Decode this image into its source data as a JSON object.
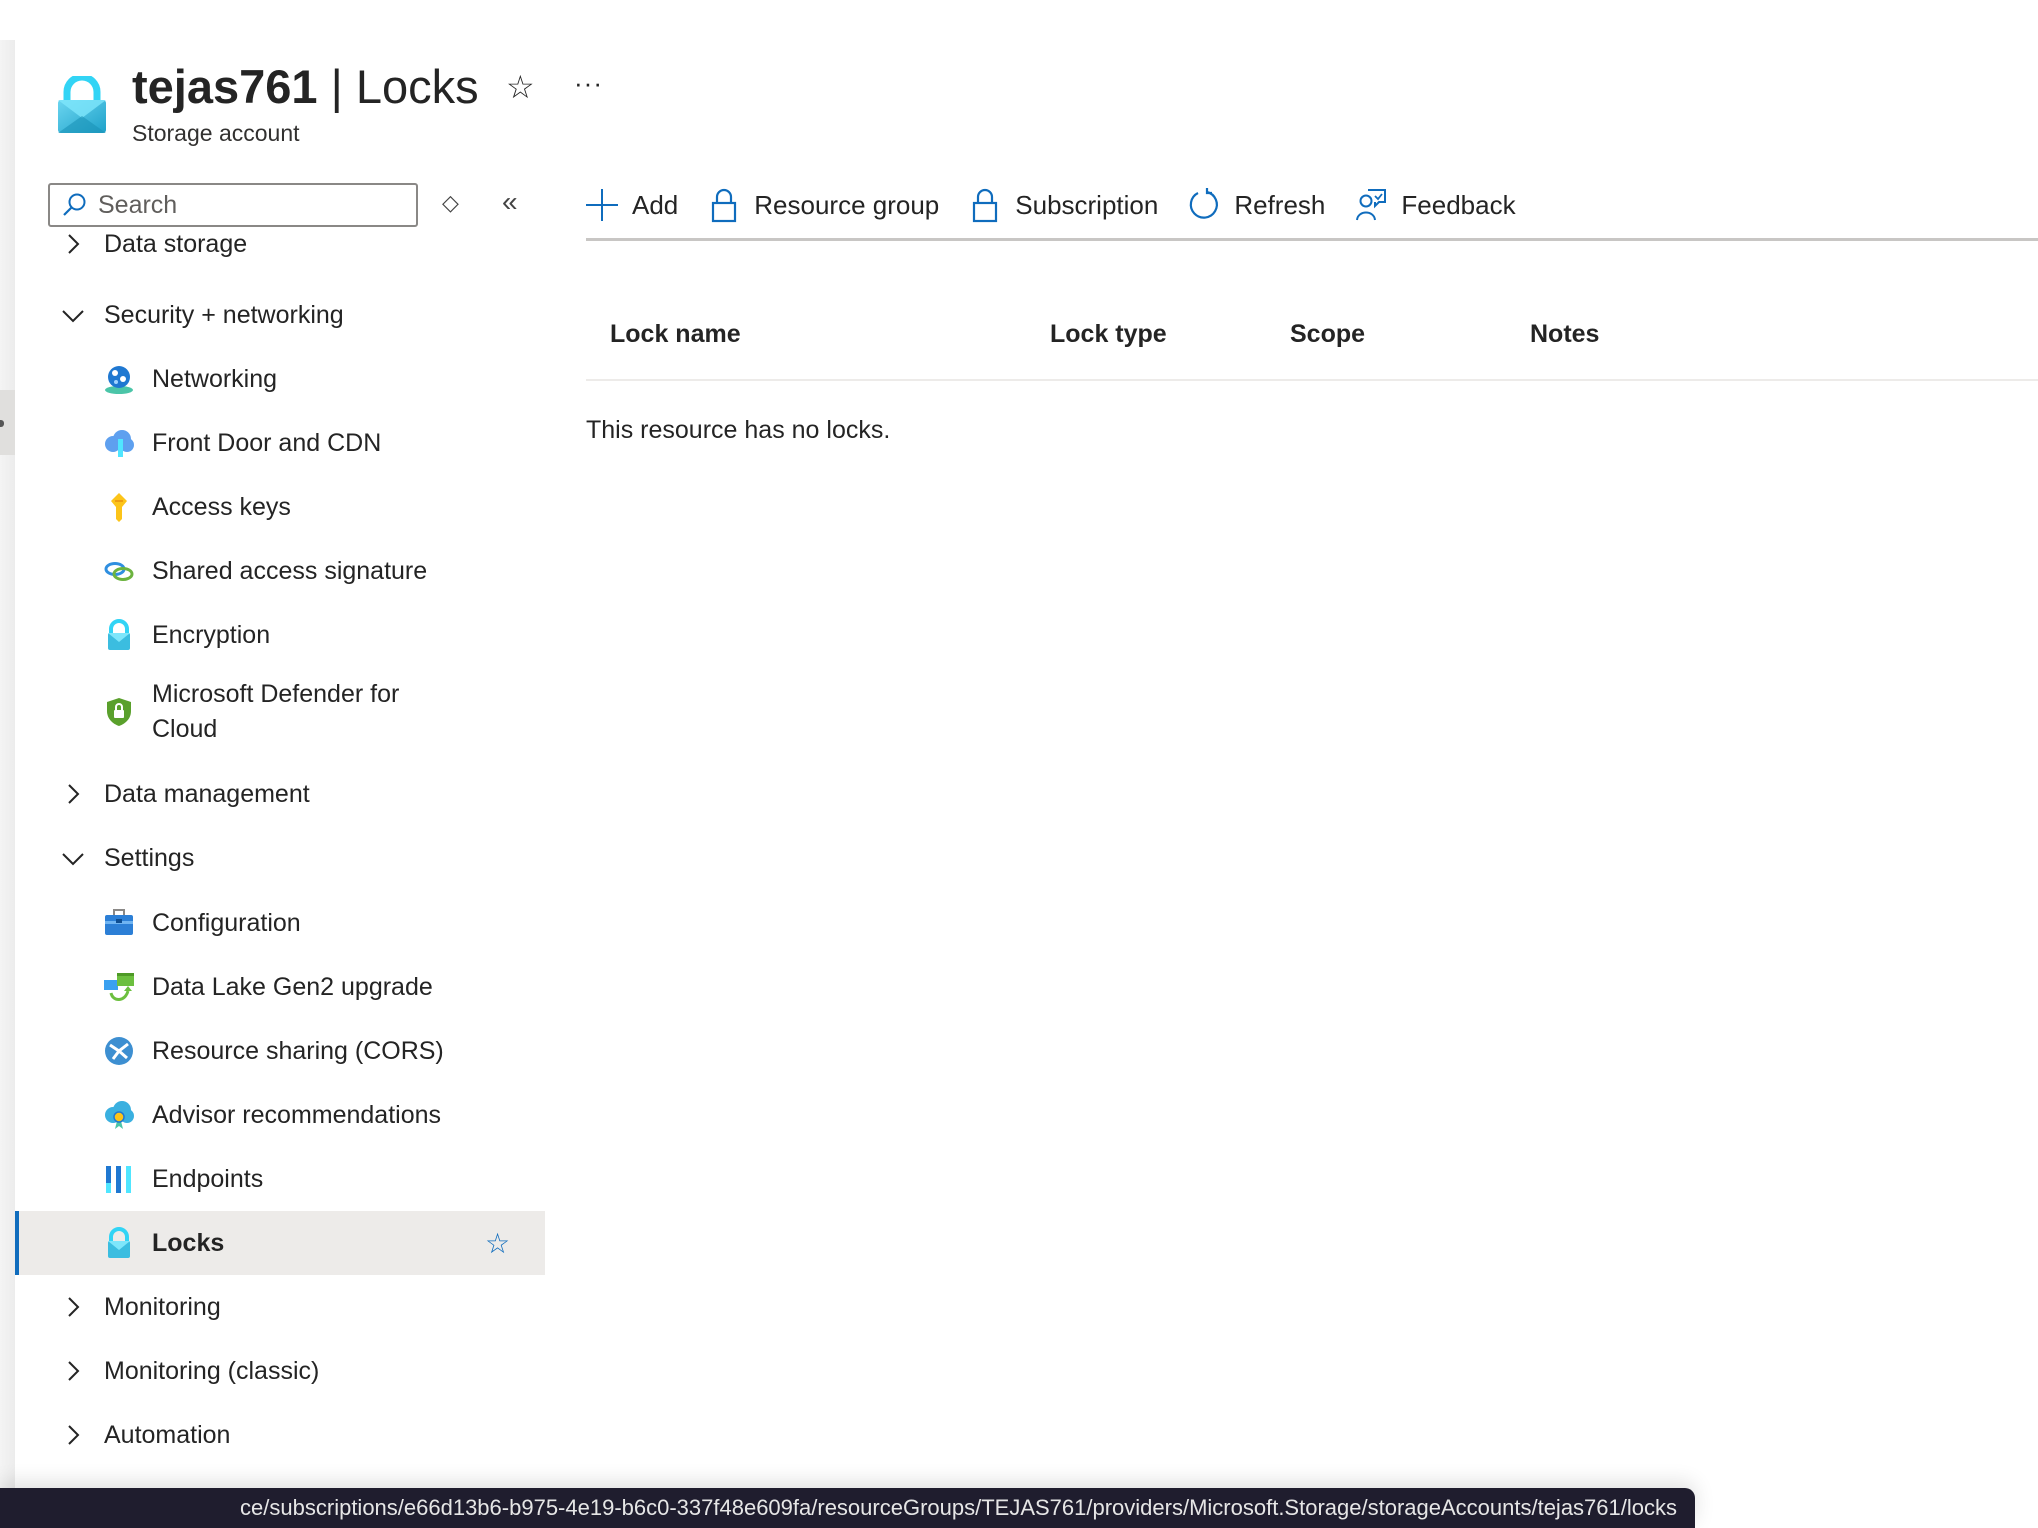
{
  "header": {
    "resource_name": "tejas761",
    "separator": " | ",
    "page_name": "Locks",
    "subtitle": "Storage account",
    "favorite_icon": "star-outline-icon",
    "more_icon": "ellipsis-icon",
    "more_label": "···",
    "star_glyph": "☆"
  },
  "sidebar": {
    "search_placeholder": "Search",
    "sort_glyph": "◇",
    "collapse_glyph": "«",
    "items": [
      {
        "type": "group",
        "label": "Data storage",
        "expanded": false
      },
      {
        "type": "group",
        "label": "Security + networking",
        "expanded": true
      },
      {
        "type": "child",
        "label": "Networking",
        "icon": "networking-globe-icon"
      },
      {
        "type": "child",
        "label": "Front Door and CDN",
        "icon": "front-door-cloud-icon"
      },
      {
        "type": "child",
        "label": "Access keys",
        "icon": "key-icon"
      },
      {
        "type": "child",
        "label": "Shared access signature",
        "icon": "link-chain-icon"
      },
      {
        "type": "child",
        "label": "Encryption",
        "icon": "lock-icon"
      },
      {
        "type": "child",
        "label": "Microsoft Defender for Cloud",
        "icon": "shield-lock-icon"
      },
      {
        "type": "group",
        "label": "Data management",
        "expanded": false
      },
      {
        "type": "group",
        "label": "Settings",
        "expanded": true
      },
      {
        "type": "child",
        "label": "Configuration",
        "icon": "toolbox-icon"
      },
      {
        "type": "child",
        "label": "Data Lake Gen2 upgrade",
        "icon": "upgrade-icon"
      },
      {
        "type": "child",
        "label": "Resource sharing (CORS)",
        "icon": "cors-icon"
      },
      {
        "type": "child",
        "label": "Advisor recommendations",
        "icon": "advisor-cloud-icon"
      },
      {
        "type": "child",
        "label": "Endpoints",
        "icon": "endpoints-bars-icon"
      },
      {
        "type": "child",
        "label": "Locks",
        "icon": "lock-icon",
        "selected": true,
        "favorite_glyph": "☆"
      },
      {
        "type": "group",
        "label": "Monitoring",
        "expanded": false
      },
      {
        "type": "group",
        "label": "Monitoring (classic)",
        "expanded": false
      },
      {
        "type": "group",
        "label": "Automation",
        "expanded": false
      }
    ]
  },
  "toolbar": {
    "add": "Add",
    "resource_group": "Resource group",
    "subscription": "Subscription",
    "refresh": "Refresh",
    "feedback": "Feedback"
  },
  "table": {
    "columns": [
      "Lock name",
      "Lock type",
      "Scope",
      "Notes"
    ],
    "rows": [],
    "empty_message": "This resource has no locks."
  },
  "status_bar": {
    "url": "ce/subscriptions/e66d13b6-b975-4e19-b6c0-337f48e609fa/resourceGroups/TEJAS761/providers/Microsoft.Storage/storageAccounts/tejas761/locks"
  },
  "colors": {
    "accent": "#0f6cbd",
    "selected_bg": "#edebe9",
    "lock_cyan": "#50e6ff"
  }
}
